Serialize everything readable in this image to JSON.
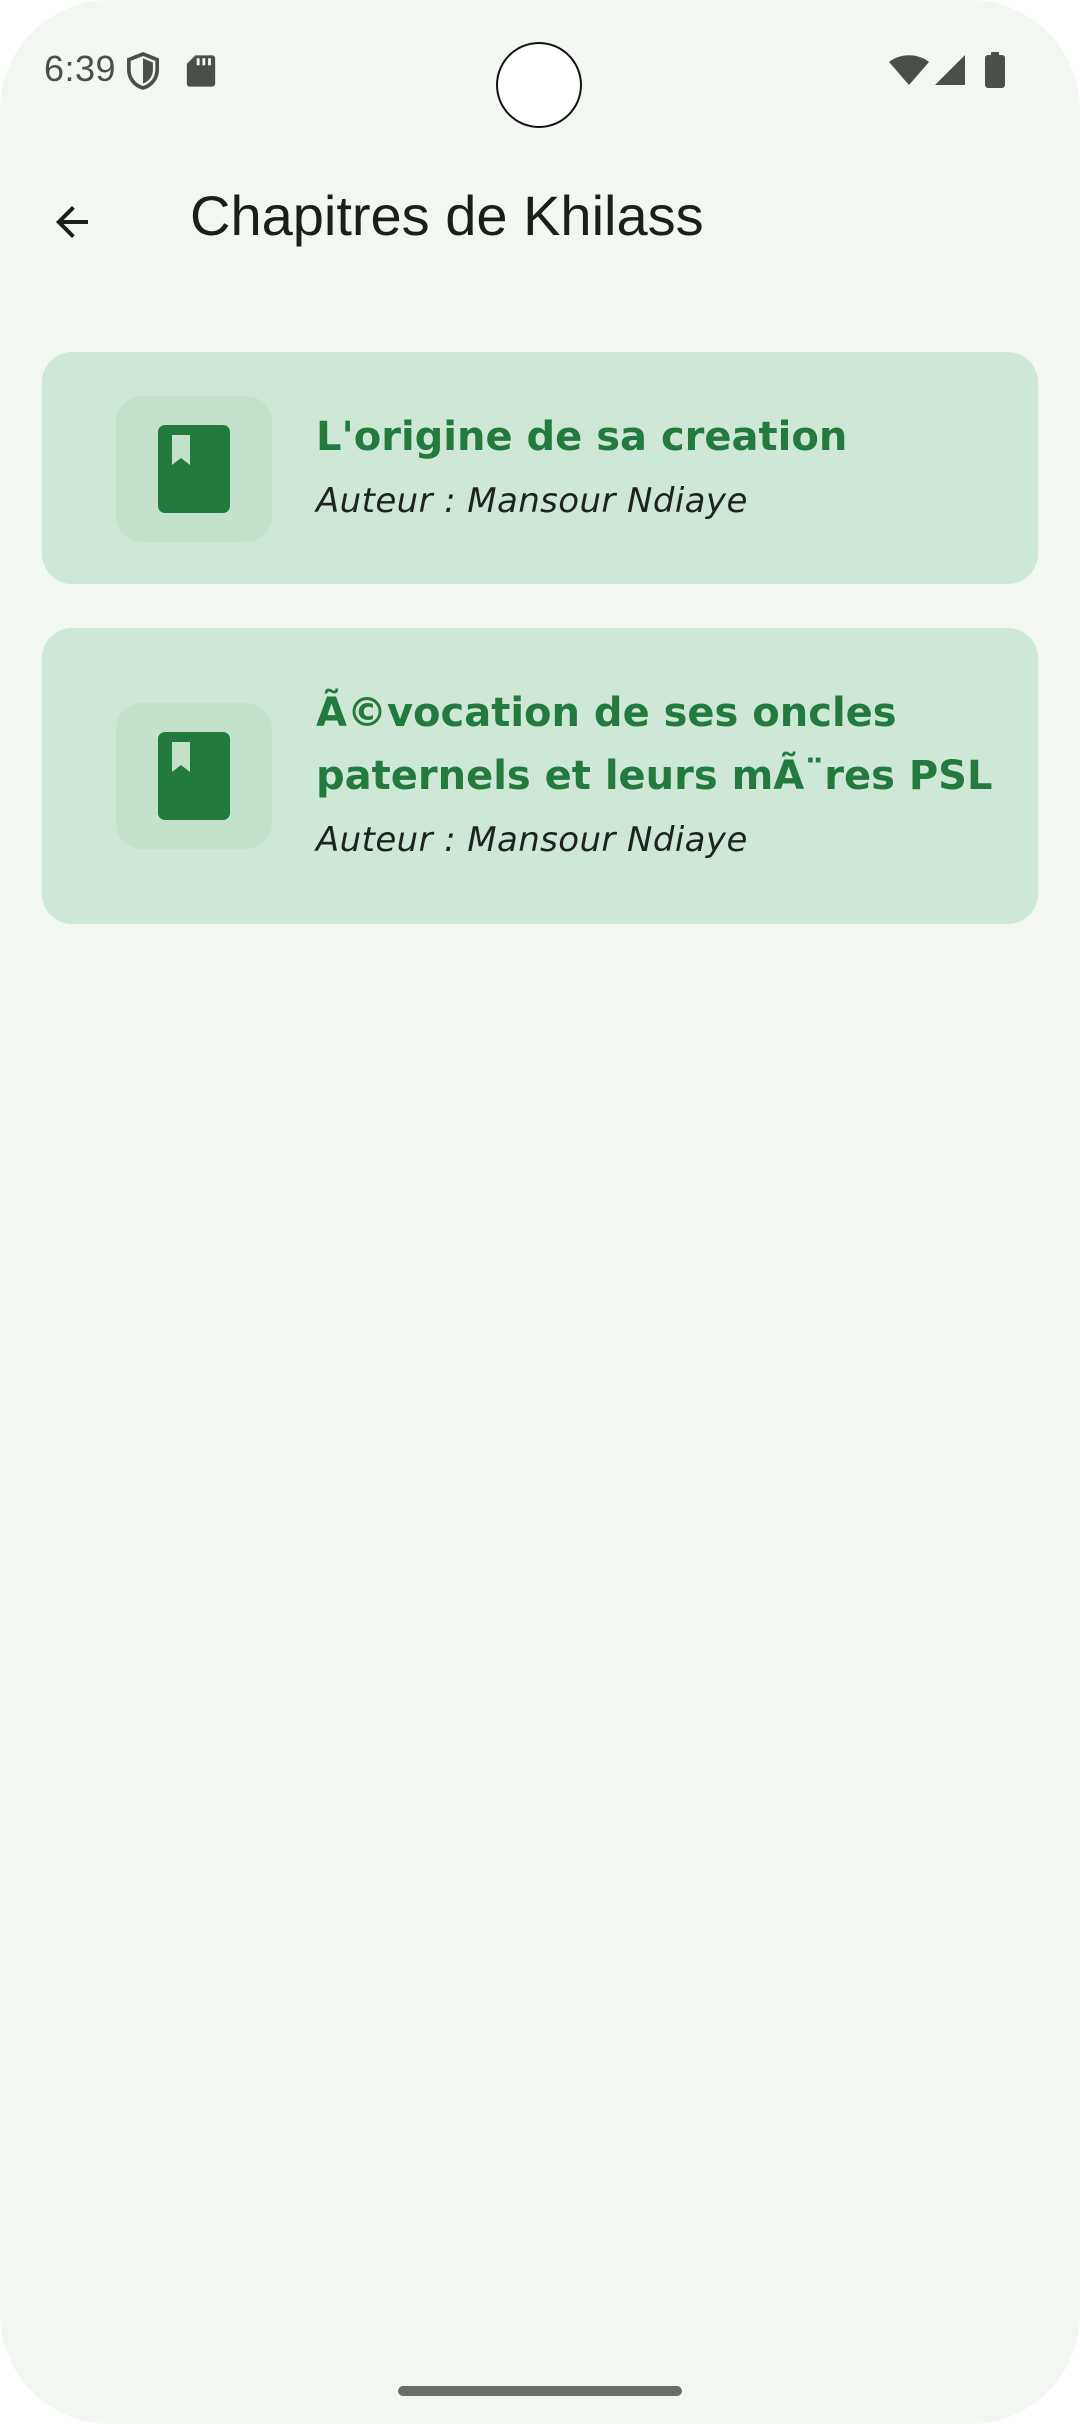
{
  "status_bar": {
    "time": "6:39",
    "icons_left": [
      "shield-icon",
      "sd-card-icon"
    ],
    "icons_right": [
      "wifi-icon",
      "cellular-signal-icon",
      "battery-icon"
    ]
  },
  "app_bar": {
    "back_icon": "arrow-left-icon",
    "title": "Chapitres de Khilass"
  },
  "chapters": [
    {
      "icon": "book-bookmark-icon",
      "title": "L'origine de sa creation",
      "author": "Auteur : Mansour Ndiaye"
    },
    {
      "icon": "book-bookmark-icon",
      "title": "Ã©vocation de ses oncles paternels et leurs mÃ¨res PSL",
      "author": "Auteur : Mansour Ndiaye"
    }
  ],
  "colors": {
    "background": "#f2f7f1",
    "card": "#cfe7d6",
    "icon_box": "#c4e2cb",
    "accent": "#237a3e",
    "title_text": "#1b1f1b"
  }
}
